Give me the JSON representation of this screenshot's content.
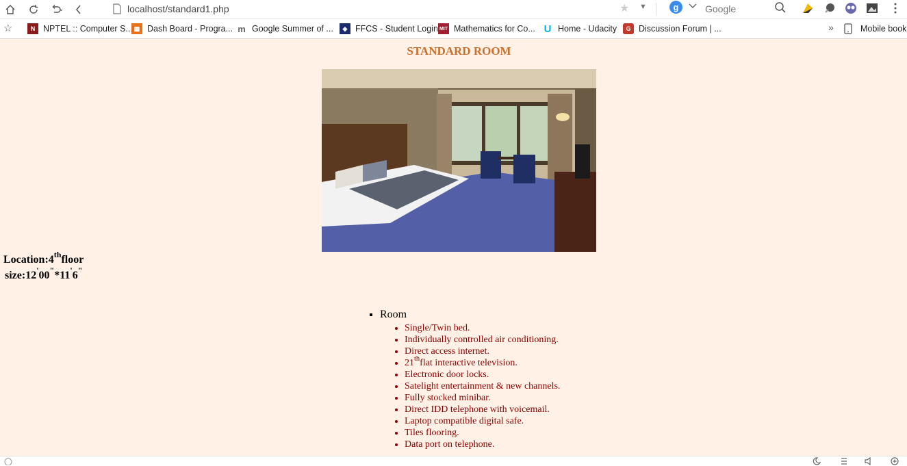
{
  "browser": {
    "url": "localhost/standard1.php",
    "search_engine_letter": "g",
    "search_placeholder": "Google",
    "bookmarks": [
      {
        "label": "NPTEL :: Computer S...",
        "icon": "nptel-icon",
        "color": "#8b1a1a"
      },
      {
        "label": "Dash Board - Progra...",
        "icon": "dashboard-icon",
        "color": "#e8701a"
      },
      {
        "label": "Google Summer of ...",
        "icon": "gsoc-icon",
        "color": "#666666"
      },
      {
        "label": "FFCS - Student Login",
        "icon": "ffcs-icon",
        "color": "#1b2a6b"
      },
      {
        "label": "Mathematics for Co...",
        "icon": "mit-icon",
        "color": "#a31f34"
      },
      {
        "label": "Home - Udacity",
        "icon": "udacity-icon",
        "color": "#02b3e4"
      },
      {
        "label": "Discussion Forum | ...",
        "icon": "forum-icon",
        "color": "#c0392b"
      }
    ],
    "mobile_bookmarks": "Mobile book"
  },
  "page": {
    "title": "STANDARD ROOM",
    "image_alt": "hotel-room-photo",
    "location": {
      "prefix": "Location:4",
      "sup": "th",
      "suffix": "floor"
    },
    "size": {
      "a": "size:12",
      "b": "00",
      "c": "*11",
      "d": "6"
    },
    "list_heading": "Room",
    "features": [
      {
        "text": "Single/Twin bed."
      },
      {
        "text": "Individually controlled air conditioning."
      },
      {
        "text": "Direct access internet."
      },
      {
        "pre": "21",
        "sup": "th",
        "text": "flat interactive television."
      },
      {
        "text": "Electronic door locks."
      },
      {
        "text": "Satelight entertainment & new channels."
      },
      {
        "text": "Fully stocked minibar."
      },
      {
        "text": "Direct IDD telephone with voicemail."
      },
      {
        "text": "Laptop compatible digital safe."
      },
      {
        "text": "Tiles flooring."
      },
      {
        "text": "Data port on telephone."
      }
    ]
  },
  "colors": {
    "page_bg": "#fff1e6",
    "title": "#c8702c",
    "feature_text": "#8b0000"
  }
}
